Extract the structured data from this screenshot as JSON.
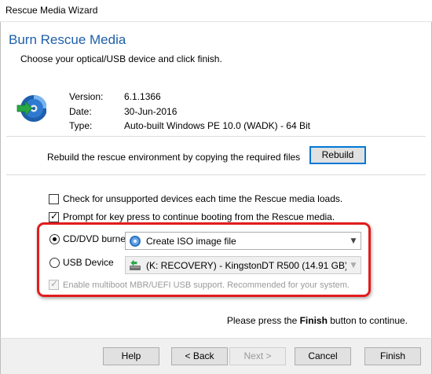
{
  "window": {
    "title": "Rescue Media Wizard"
  },
  "header": {
    "title": "Burn Rescue Media",
    "subtitle": "Choose your optical/USB device and click finish."
  },
  "info": {
    "version_label": "Version:",
    "version_value": "6.1.1366",
    "date_label": "Date:",
    "date_value": "30-Jun-2016",
    "type_label": "Type:",
    "type_value": "Auto-built Windows PE 10.0 (WADK) - 64 Bit"
  },
  "rebuild": {
    "text": "Rebuild the rescue environment by copying the required files",
    "button": "Rebuild"
  },
  "options": {
    "check_unsupported": {
      "label": "Check for unsupported devices each time the Rescue media loads.",
      "checked": false
    },
    "prompt_key": {
      "label": "Prompt for key press to continue booting from the Rescue media.",
      "checked": true
    }
  },
  "devices": {
    "cd_label": "CD/DVD burner",
    "cd_selected": true,
    "cd_combo_value": "Create ISO image file",
    "usb_label": "USB Device",
    "usb_selected": false,
    "usb_combo_value": "(K: RECOVERY) - KingstonDT R500 (14.91 GB)",
    "multiboot_label": "Enable multiboot MBR/UEFI USB support. Recommended for your system.",
    "multiboot_checked": true
  },
  "finish_message": {
    "prefix": "Please press the ",
    "emphasis": "Finish",
    "suffix": " button to continue."
  },
  "footer": {
    "help": "Help",
    "back": "< Back",
    "next": "Next >",
    "cancel": "Cancel",
    "finish": "Finish"
  },
  "colors": {
    "heading": "#1f5fa8",
    "highlight": "#e21c1c",
    "accent": "#0078d7"
  }
}
